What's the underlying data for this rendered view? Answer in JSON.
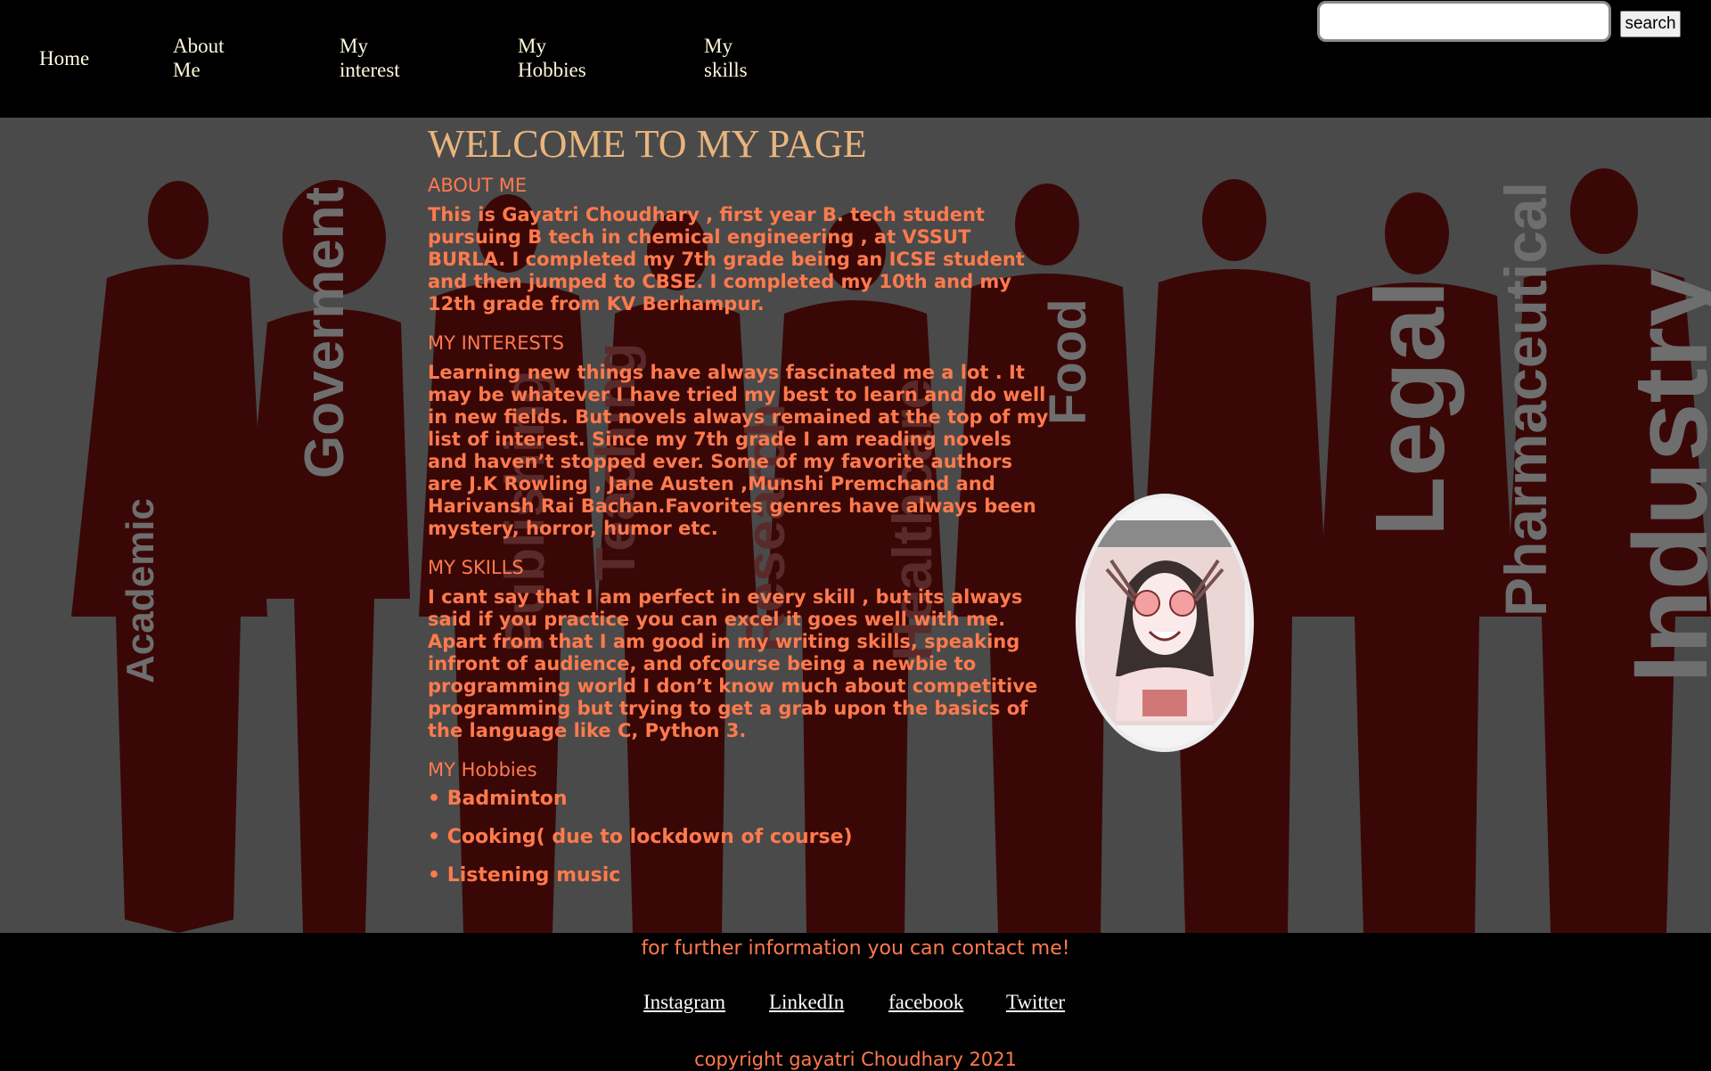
{
  "nav": {
    "home": "Home",
    "about": [
      "About",
      "Me"
    ],
    "interest": [
      "My",
      "interest"
    ],
    "hobbies": [
      "My",
      "Hobbies"
    ],
    "skills": [
      "My",
      "skills"
    ]
  },
  "search": {
    "value": "",
    "button_label": "search"
  },
  "background_words": [
    "Academic",
    "Goverment",
    "Publishing",
    "Teaching",
    "Research",
    "Healthcare",
    "Food",
    "Legal",
    "Pharmaceutical",
    "Industry"
  ],
  "main": {
    "title": "WELCOME TO MY PAGE",
    "about_heading": "ABOUT ME",
    "about_text": "This is Gayatri Choudhary , first year B. tech student pursuing B tech in chemical engineering , at VSSUT BURLA. I completed my 7th grade being an ICSE student and then jumped to CBSE. I completed my 10th and my 12th grade from KV Berhampur.",
    "interests_heading": "MY INTERESTS",
    "interests_text": "Learning new things have always fascinated me a lot . It may be whatever I have tried my best to learn and do well in new fields. But novels always remained at the top of my list of interest. Since my 7th grade I am reading novels and haven’t stopped ever. Some of my favorite authors are J.K Rowling , Jane Austen ,Munshi Premchand and Harivansh Rai Bachan.Favorites genres have always been mystery, horror, humor etc.",
    "skills_heading": "MY SKILLS",
    "skills_text": "I cant say that I am perfect in every skill , but its always said if you practice you can excel it goes well with me. Apart from that I am good in my writing skills, speaking infront of audience, and ofcourse being a newbie to programming world I don’t know much about competitive programming but trying to get a grab upon the basics of the language like C, Python 3.",
    "hobbies_heading": "MY Hobbies",
    "hobbies": [
      "• Badminton",
      "• Cooking( due to lockdown of course)",
      "• Listening music"
    ]
  },
  "footer": {
    "contact": "for further information you can contact me!",
    "links": [
      "Instagram",
      "LinkedIn",
      "facebook",
      "Twitter"
    ],
    "copyright": "copyright gayatri Choudhary 2021"
  },
  "colors": {
    "accent": "#ff7a4d",
    "title": "#e9b57e",
    "silhouette": "#3a0707",
    "background_gray": "#4a4a4a"
  }
}
